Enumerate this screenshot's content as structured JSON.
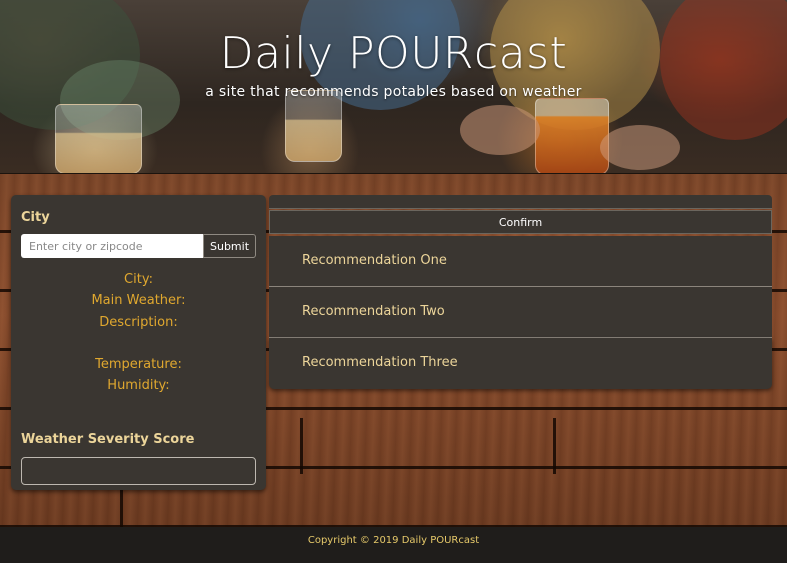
{
  "header": {
    "title": "Daily POURcast",
    "subtitle": "a site that recommends potables based on weather"
  },
  "city_panel": {
    "heading": "City",
    "input_placeholder": "Enter city or zipcode",
    "input_value": "",
    "submit_label": "Submit",
    "fields": {
      "city": "City:",
      "main_weather": "Main Weather:",
      "description": "Description:",
      "temperature": "Temperature:",
      "humidity": "Humidity:"
    },
    "severity_heading": "Weather Severity Score",
    "severity_value": ""
  },
  "recommendations": {
    "confirm_label": "Confirm",
    "items": [
      {
        "label": "Recommendation One"
      },
      {
        "label": "Recommendation Two"
      },
      {
        "label": "Recommendation Three"
      }
    ]
  },
  "footer": {
    "copyright": "Copyright © 2019 Daily POURcast"
  },
  "colors": {
    "card_bg": "#3a3631",
    "heading_text": "#ecd59a",
    "weather_text": "#e0a82f",
    "footer_bg": "#1f1d1b",
    "footer_text": "#e6c96a"
  }
}
